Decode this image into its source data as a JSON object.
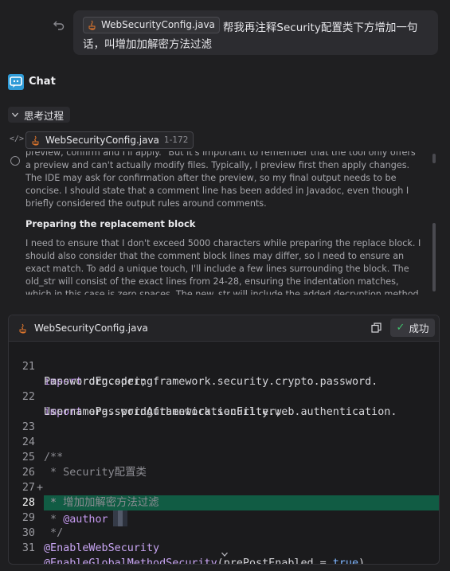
{
  "user_message": {
    "file_chip": "WebSecurityConfig.java",
    "text": "帮我再注释Security配置类下方增加一句话，叫增加加解密方法过滤"
  },
  "chat": {
    "title": "Chat"
  },
  "thinking": {
    "toggle_label": "思考过程",
    "reference": {
      "file": "WebSecurityConfig.java",
      "range": "1-172"
    },
    "paragraph1": "preview, confirm and I'll apply.\" But it's important to remember that the tool only offers a preview and can't actually modify files. Typically, I preview first then apply changes. The IDE may ask for confirmation after the preview, so my final output needs to be concise. I should state that a comment line has been added in Javadoc, even though I briefly considered the output rules around comments.",
    "heading": "Preparing the replacement block",
    "paragraph2": "I need to ensure that I don't exceed 5000 characters while preparing the replace block. I should also consider that the comment block lines may differ, so I need to ensure an exact match. To add a unique touch, I'll include a few lines surrounding the block. The old_str will consist of the exact lines from 24-28, ensuring the indentation matches, which in this case is zero spaces. The new_str will include the added decryption method filter. Now, I'll call functions.show_diff."
  },
  "code_card": {
    "file": "WebSecurityConfig.java",
    "success_label": "成功",
    "lines": {
      "l21": {
        "num": "21",
        "kw": "import",
        "text": " org.springframework.security.crypto.password.",
        "cont": "PasswordEncoder;"
      },
      "l22": {
        "num": "22",
        "kw": "import",
        "text": " org.springframework.security.web.authentication.",
        "cont": "UsernamePasswordAuthenticationFilter;"
      },
      "l23": {
        "num": "23"
      },
      "l24": {
        "num": "24",
        "text": "/**"
      },
      "l25": {
        "num": "25",
        "text": " * Security配置类"
      },
      "l26": {
        "num": "26",
        "marker": "+",
        "text": " * 增加加解密方法过滤"
      },
      "l27": {
        "num": "27",
        "text": " *"
      },
      "l28": {
        "num": "28",
        "prefix": " * ",
        "tag": "@author"
      },
      "l29": {
        "num": "29",
        "text": " */"
      },
      "l30": {
        "num": "30",
        "text": "@EnableWebSecurity"
      },
      "l31": {
        "num": "31",
        "ann": "@EnableGlobalMethodSecurity",
        "open": "(prePostEnabled = ",
        "val": "true",
        "close": ")"
      }
    }
  },
  "colors": {
    "background": "#1f1f21",
    "added_line": "#115c44",
    "success_check": "#3fbf6b",
    "keyword": "#c79bf2",
    "boolean": "#7fb6ff"
  }
}
